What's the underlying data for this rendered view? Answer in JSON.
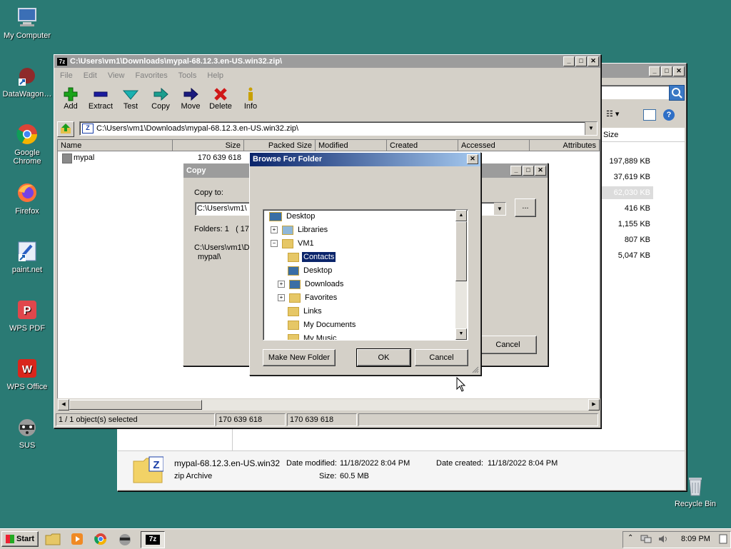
{
  "desktop": {
    "icons": [
      {
        "label": "My Computer",
        "icon": "computer-icon"
      },
      {
        "label": "DataWagon…",
        "icon": "datawagon-icon"
      },
      {
        "label": "Google Chrome",
        "icon": "chrome-icon"
      },
      {
        "label": "Firefox",
        "icon": "firefox-icon"
      },
      {
        "label": "paint.net",
        "icon": "paintnet-icon"
      },
      {
        "label": "WPS PDF",
        "icon": "wps-pdf-icon"
      },
      {
        "label": "WPS Office",
        "icon": "wps-office-icon"
      },
      {
        "label": "SUS",
        "icon": "raccoon-icon"
      }
    ],
    "recycle_bin": "Recycle Bin"
  },
  "explorer": {
    "size_header": "Size",
    "sizes": [
      "197,889 KB",
      "37,619 KB",
      "62,030 KB",
      "416 KB",
      "1,155 KB",
      "807 KB",
      "5,047 KB"
    ],
    "details": {
      "filename": "mypal-68.12.3.en-US.win32",
      "type": "zip Archive",
      "date_modified_label": "Date modified:",
      "date_modified": "11/18/2022 8:04 PM",
      "date_created_label": "Date created:",
      "date_created": "11/18/2022 8:04 PM",
      "size_label": "Size:",
      "size": "60.5 MB"
    }
  },
  "sevenzip": {
    "title": "C:\\Users\\vm1\\Downloads\\mypal-68.12.3.en-US.win32.zip\\",
    "menu": [
      "File",
      "Edit",
      "View",
      "Favorites",
      "Tools",
      "Help"
    ],
    "toolbar": [
      {
        "label": "Add",
        "icon": "plus-icon",
        "color": "#1aa31a"
      },
      {
        "label": "Extract",
        "icon": "minus-icon",
        "color": "#1a1a9e"
      },
      {
        "label": "Test",
        "icon": "check-icon",
        "color": "#1ab0b0"
      },
      {
        "label": "Copy",
        "icon": "arrow-right-icon",
        "color": "#1a9e8e"
      },
      {
        "label": "Move",
        "icon": "arrow-right-icon",
        "color": "#1a1a7e"
      },
      {
        "label": "Delete",
        "icon": "x-icon",
        "color": "#d01818"
      },
      {
        "label": "Info",
        "icon": "info-icon",
        "color": "#c8a000"
      }
    ],
    "address": "C:\\Users\\vm1\\Downloads\\mypal-68.12.3.en-US.win32.zip\\",
    "columns": [
      "Name",
      "Size",
      "Packed Size",
      "Modified",
      "Created",
      "Accessed",
      "Attributes"
    ],
    "rows": [
      {
        "name": "mypal",
        "size": "170 639 618"
      }
    ],
    "status": [
      "1 / 1 object(s) selected",
      "170 639 618",
      "170 639 618"
    ]
  },
  "copy_dialog": {
    "title": "Copy",
    "copy_to_label": "Copy to:",
    "path_value": "C:\\Users\\vm1\\",
    "browse_label": "...",
    "folders_text": "Folders: 1   ( 17",
    "source_path": "C:\\Users\\vm1\\D",
    "source_item": "mypal\\",
    "cancel_label": "Cancel"
  },
  "browse_dialog": {
    "title": "Browse For Folder",
    "close": "✕",
    "tree": [
      {
        "label": "Desktop",
        "level": 0,
        "expander": "",
        "icon": "desktop-icon",
        "selected": false
      },
      {
        "label": "Libraries",
        "level": 1,
        "expander": "+",
        "icon": "libraries-icon",
        "selected": false
      },
      {
        "label": "VM1",
        "level": 1,
        "expander": "−",
        "icon": "user-folder-icon",
        "selected": false
      },
      {
        "label": "Contacts",
        "level": 2,
        "expander": "",
        "icon": "contacts-icon",
        "selected": true
      },
      {
        "label": "Desktop",
        "level": 2,
        "expander": "",
        "icon": "desktop-folder-icon",
        "selected": false
      },
      {
        "label": "Downloads",
        "level": 2,
        "expander": "+",
        "icon": "downloads-icon",
        "selected": false
      },
      {
        "label": "Favorites",
        "level": 2,
        "expander": "+",
        "icon": "favorites-icon",
        "selected": false
      },
      {
        "label": "Links",
        "level": 2,
        "expander": "",
        "icon": "links-icon",
        "selected": false
      },
      {
        "label": "My Documents",
        "level": 2,
        "expander": "",
        "icon": "documents-icon",
        "selected": false
      },
      {
        "label": "My Music",
        "level": 2,
        "expander": "",
        "icon": "music-icon",
        "selected": false
      }
    ],
    "make_new_folder": "Make New Folder",
    "ok": "OK",
    "cancel": "Cancel"
  },
  "taskbar": {
    "start": "Start",
    "clock": "8:09 PM"
  },
  "colors": {
    "desktop": "#2a7a74",
    "selection": "#0a246a"
  }
}
